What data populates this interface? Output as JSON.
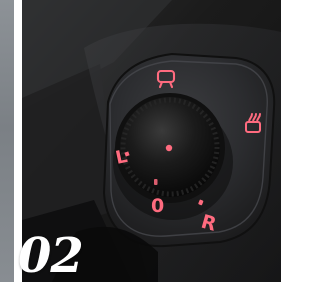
{
  "photo": {
    "control_labels": {
      "left": "L",
      "zero": "0",
      "right": "R"
    },
    "icons": {
      "mirror_adjust": "side-mirror-icon",
      "heated_mirror": "heated-mirror-icon"
    },
    "colors": {
      "background": "#171717",
      "panel": "#2a2b2d",
      "knob": "#111111",
      "indicator": "#ff6b7f"
    }
  },
  "caption": {
    "number": "02"
  }
}
